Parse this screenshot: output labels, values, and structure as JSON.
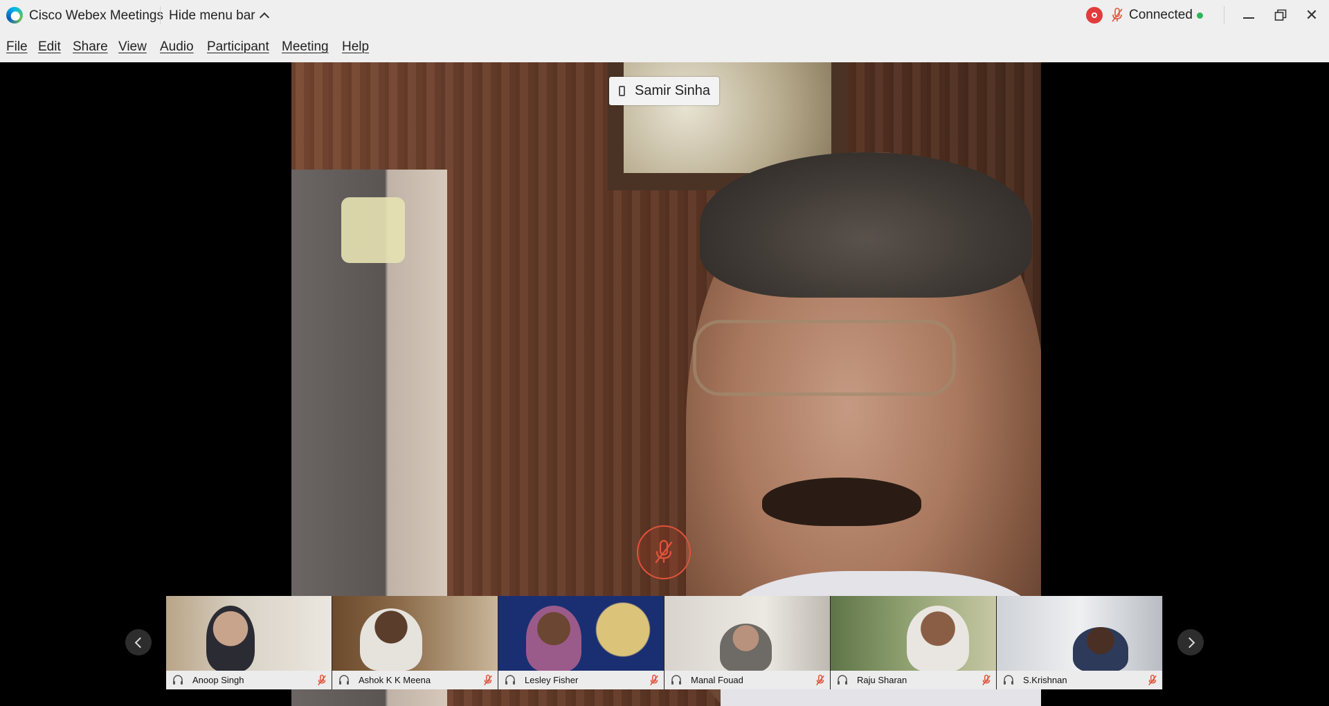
{
  "app": {
    "title": "Cisco Webex Meetings",
    "hide_menu_label": "Hide menu bar",
    "connection_status": "Connected",
    "status_color": "#2fb45a",
    "recording_color": "#e23b3b"
  },
  "window_controls": {
    "minimize": "minimize-icon",
    "maximize": "restore-icon",
    "close": "✕"
  },
  "menu": {
    "items": [
      "File",
      "Edit",
      "Share",
      "View",
      "Audio",
      "Participant",
      "Meeting",
      "Help"
    ]
  },
  "active_speaker": {
    "name": "Samir Sinha",
    "device_icon": "phone-icon",
    "muted": true
  },
  "filmstrip": {
    "participants": [
      {
        "name": "Anoop Singh",
        "audio_icon": "headset-icon",
        "muted": true
      },
      {
        "name": "Ashok K K Meena",
        "audio_icon": "headset-icon",
        "muted": true
      },
      {
        "name": "Lesley Fisher",
        "audio_icon": "headset-icon",
        "muted": true
      },
      {
        "name": "Manal Fouad",
        "audio_icon": "headset-icon",
        "muted": true
      },
      {
        "name": "Raju Sharan",
        "audio_icon": "headset-icon",
        "muted": true
      },
      {
        "name": "S.Krishnan",
        "audio_icon": "headset-icon",
        "muted": true
      }
    ],
    "prev_icon": "chevron-left-icon",
    "next_icon": "chevron-right-icon"
  }
}
